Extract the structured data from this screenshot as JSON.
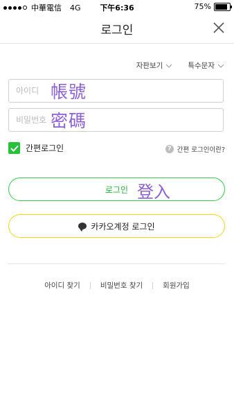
{
  "status_bar": {
    "carrier": "中華電信",
    "network": "4G",
    "time": "下午6:36",
    "battery": "75%",
    "battery_level": 0.75
  },
  "header": {
    "title": "로그인",
    "close_icon": "close-icon"
  },
  "options": {
    "keyboard_view": "자판보기",
    "special_chars": "특수문자"
  },
  "form": {
    "id_placeholder": "아이디",
    "id_annotation": "帳號",
    "pw_placeholder": "비밀번호",
    "pw_annotation": "密碼"
  },
  "easy_login": {
    "label": "간편로그인",
    "checked": true,
    "help_text": "간편 로그인이란?"
  },
  "buttons": {
    "login": "로그인",
    "login_annotation": "登入",
    "kakao_login": "카카오계정 로그인"
  },
  "links": {
    "find_id": "아이디 찾기",
    "find_pw": "비밀번호 찾기",
    "signup": "회원가입"
  },
  "colors": {
    "accent_green": "#27c13c",
    "kakao_yellow": "#f2d71a",
    "annotation_purple": "#8b5fd6"
  }
}
